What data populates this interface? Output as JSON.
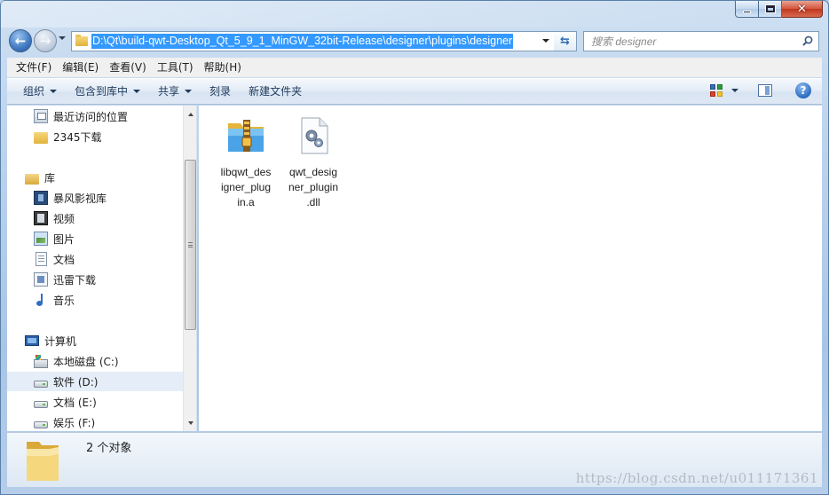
{
  "window": {
    "title": "",
    "address_path": "D:\\Qt\\build-qwt-Desktop_Qt_5_9_1_MinGW_32bit-Release\\designer\\plugins\\designer",
    "search_placeholder": "搜索 designer"
  },
  "caption_buttons": {
    "close_glyph": "✕"
  },
  "menu": {
    "items": [
      "文件(F)",
      "编辑(E)",
      "查看(V)",
      "工具(T)",
      "帮助(H)"
    ]
  },
  "commands": {
    "organize": "组织",
    "include_in_library": "包含到库中",
    "share": "共享",
    "burn": "刻录",
    "new_folder": "新建文件夹",
    "help_glyph": "?"
  },
  "navigation": {
    "items": [
      {
        "label": "最近访问的位置",
        "icon": "recent-places-icon"
      },
      {
        "label": "2345下载",
        "icon": "folder-icon"
      },
      {
        "label": "库",
        "icon": "library-icon"
      },
      {
        "label": "暴风影视库",
        "icon": "video-library-icon"
      },
      {
        "label": "视频",
        "icon": "film-icon"
      },
      {
        "label": "图片",
        "icon": "picture-icon"
      },
      {
        "label": "文档",
        "icon": "document-icon"
      },
      {
        "label": "迅雷下载",
        "icon": "download-icon"
      },
      {
        "label": "音乐",
        "icon": "music-icon"
      },
      {
        "label": "计算机",
        "icon": "computer-icon"
      },
      {
        "label": "本地磁盘 (C:)",
        "icon": "system-drive-icon"
      },
      {
        "label": "软件 (D:)",
        "icon": "drive-icon",
        "selected": true
      },
      {
        "label": "文档 (E:)",
        "icon": "drive-icon"
      },
      {
        "label": "娱乐 (F:)",
        "icon": "drive-icon"
      }
    ]
  },
  "files": [
    {
      "name": "libqwt_designer_plugin.a",
      "line1": "libqwt_des",
      "line2": "igner_plug",
      "line3": "in.a",
      "icon": "archive-icon"
    },
    {
      "name": "qwt_designer_plugin.dll",
      "line1": "qwt_desig",
      "line2": "ner_plugin",
      "line3": ".dll",
      "icon": "dll-settings-icon"
    }
  ],
  "details": {
    "item_count": "2 个对象"
  },
  "watermark": "https://blog.csdn.net/u011171361",
  "colors": {
    "frame": "#b9d1ea",
    "selection": "#3399ff",
    "accent": "#1e395b"
  }
}
